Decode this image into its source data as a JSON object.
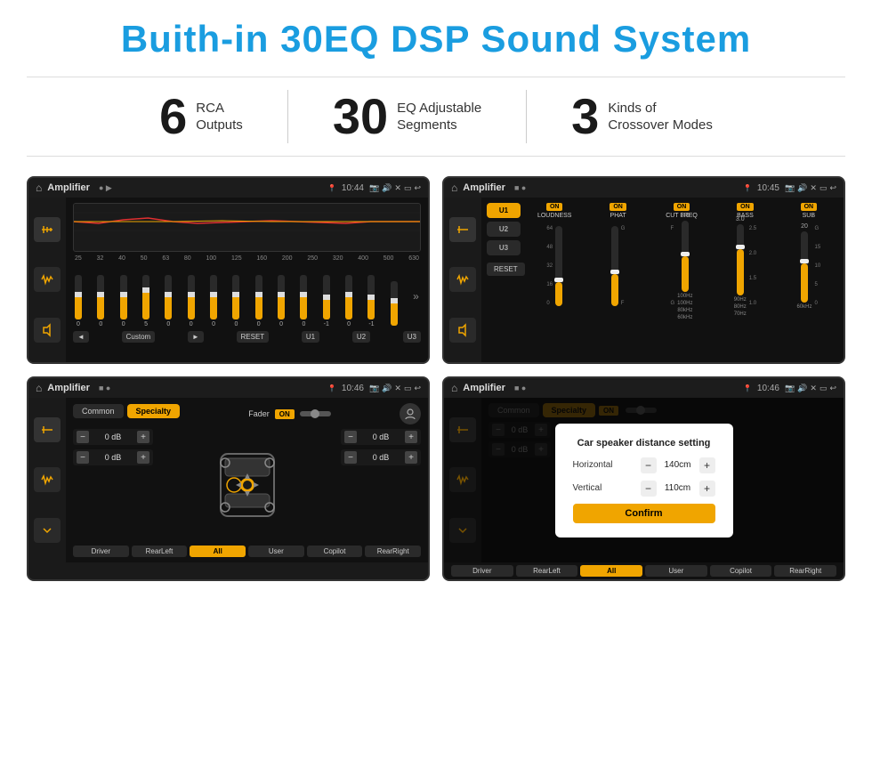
{
  "header": {
    "title": "Buith-in 30EQ DSP Sound System"
  },
  "stats": [
    {
      "number": "6",
      "label": "RCA\nOutputs"
    },
    {
      "number": "30",
      "label": "EQ Adjustable\nSegments"
    },
    {
      "number": "3",
      "label": "Kinds of\nCrossover Modes"
    }
  ],
  "screens": {
    "screen1": {
      "app_name": "Amplifier",
      "time": "10:44",
      "eq_freqs": [
        "25",
        "32",
        "40",
        "50",
        "63",
        "80",
        "100",
        "125",
        "160",
        "200",
        "250",
        "320",
        "400",
        "500",
        "630"
      ],
      "eq_values": [
        "0",
        "0",
        "0",
        "5",
        "0",
        "0",
        "0",
        "0",
        "0",
        "0",
        "0",
        "-1",
        "0",
        "-1",
        ""
      ],
      "eq_sliders": [
        50,
        50,
        50,
        60,
        50,
        50,
        50,
        50,
        50,
        50,
        50,
        45,
        50,
        45,
        50
      ],
      "controls": [
        "◄",
        "Custom",
        "►",
        "RESET",
        "U1",
        "U2",
        "U3"
      ]
    },
    "screen2": {
      "app_name": "Amplifier",
      "time": "10:45",
      "presets": [
        "U1",
        "U2",
        "U3"
      ],
      "channels": [
        {
          "label": "LOUDNESS",
          "on": true
        },
        {
          "label": "PHAT",
          "on": true
        },
        {
          "label": "CUT FREQ",
          "on": true
        },
        {
          "label": "BASS",
          "on": true
        },
        {
          "label": "SUB",
          "on": true
        }
      ],
      "reset_label": "RESET"
    },
    "screen3": {
      "app_name": "Amplifier",
      "time": "10:46",
      "tabs": [
        "Common",
        "Specialty"
      ],
      "fader_label": "Fader",
      "fader_on": "ON",
      "left_controls": [
        "0 dB",
        "0 dB"
      ],
      "right_controls": [
        "0 dB",
        "0 dB"
      ],
      "bottom_btns": [
        "Driver",
        "RearLeft",
        "All",
        "User",
        "Copilot",
        "RearRight"
      ]
    },
    "screen4": {
      "app_name": "Amplifier",
      "time": "10:46",
      "tabs": [
        "Common",
        "Specialty"
      ],
      "dialog": {
        "title": "Car speaker distance setting",
        "horizontal_label": "Horizontal",
        "horizontal_value": "140cm",
        "vertical_label": "Vertical",
        "vertical_value": "110cm",
        "confirm_label": "Confirm"
      },
      "left_controls": [
        "0 dB",
        "0 dB"
      ],
      "right_controls": [
        "0 dB",
        "0 dB"
      ],
      "bottom_btns": [
        "Driver",
        "RearLeft",
        "All",
        "User",
        "Copilot",
        "RearRight"
      ]
    }
  }
}
